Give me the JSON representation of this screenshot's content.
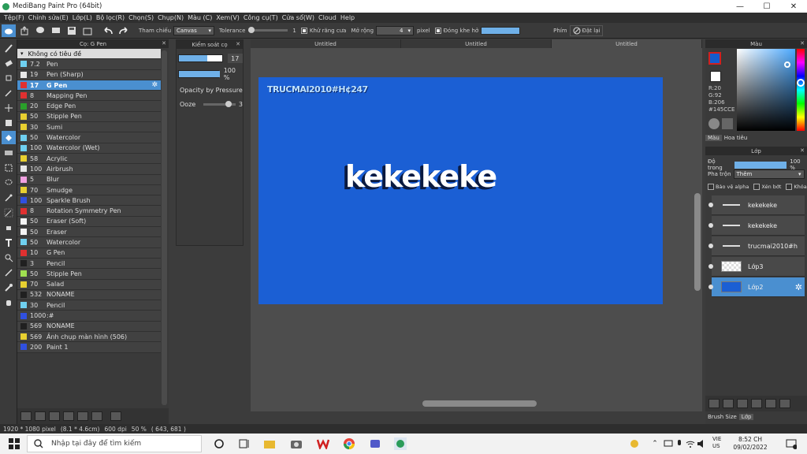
{
  "window": {
    "title": "MediBang Paint Pro (64bit)",
    "min": "—",
    "max": "☐",
    "close": "✕"
  },
  "menu": [
    "Tệp(F)",
    "Chỉnh sửa(E)",
    "Lớp(L)",
    "Bộ lọc(R)",
    "Chọn(S)",
    "Chụp(N)",
    "Màu (C)",
    "Xem(V)",
    "Công cụ(T)",
    "Cửa sổ(W)",
    "Cloud",
    "Help"
  ],
  "toolbar": {
    "reference_label": "Tham chiếu",
    "reference_value": "Canvas",
    "tolerance_label": "Tolerance",
    "tolerance_value": "1",
    "antialias_label": "Khử răng cưa",
    "expand_label": "Mở rộng",
    "expand_value": "4",
    "expand_unit": "pixel",
    "gap_label": "Đóng khe hở",
    "phim_label": "Phím",
    "reset_label": "Đặt lại"
  },
  "brush_panel": {
    "title": "Cọ: G Pen",
    "category": "Không có tiêu đề",
    "items": [
      {
        "size": "7.2",
        "name": "Pen",
        "color": "#6fd0f0",
        "selected": false
      },
      {
        "size": "19",
        "name": "Pen (Sharp)",
        "color": "#e8e8e8",
        "selected": false
      },
      {
        "size": "17",
        "name": "G Pen",
        "color": "#e03030",
        "selected": true
      },
      {
        "size": "8",
        "name": "Mapping Pen",
        "color": "#e03030",
        "selected": false
      },
      {
        "size": "20",
        "name": "Edge Pen",
        "color": "#2aa02a",
        "selected": false
      },
      {
        "size": "50",
        "name": "Stipple Pen",
        "color": "#e8d030",
        "selected": false
      },
      {
        "size": "30",
        "name": "Sumi",
        "color": "#e8d030",
        "selected": false
      },
      {
        "size": "50",
        "name": "Watercolor",
        "color": "#6fd0f0",
        "selected": false
      },
      {
        "size": "100",
        "name": "Watercolor (Wet)",
        "color": "#6fd0f0",
        "selected": false
      },
      {
        "size": "58",
        "name": "Acrylic",
        "color": "#e8d030",
        "selected": false
      },
      {
        "size": "100",
        "name": "Airbrush",
        "color": "#e8e8e8",
        "selected": false
      },
      {
        "size": "5",
        "name": "Blur",
        "color": "#f0a0e0",
        "selected": false
      },
      {
        "size": "70",
        "name": "Smudge",
        "color": "#e8d030",
        "selected": false
      },
      {
        "size": "100",
        "name": "Sparkle Brush",
        "color": "#3050e0",
        "selected": false
      },
      {
        "size": "8",
        "name": "Rotation Symmetry Pen",
        "color": "#e03030",
        "selected": false
      },
      {
        "size": "50",
        "name": "Eraser (Soft)",
        "color": "#f4f4f4",
        "selected": false
      },
      {
        "size": "50",
        "name": "Eraser",
        "color": "#f4f4f4",
        "selected": false
      },
      {
        "size": "50",
        "name": "Watercolor",
        "color": "#6fd0f0",
        "selected": false
      },
      {
        "size": "10",
        "name": "G Pen",
        "color": "#e03030",
        "selected": false
      },
      {
        "size": "3",
        "name": "Pencil",
        "color": "#202020",
        "selected": false
      },
      {
        "size": "50",
        "name": "Stipple Pen",
        "color": "#a0e050",
        "selected": false
      },
      {
        "size": "70",
        "name": "Salad",
        "color": "#e8d030",
        "selected": false
      },
      {
        "size": "532",
        "name": "NONAME",
        "color": "#202020",
        "selected": false
      },
      {
        "size": "30",
        "name": "Pencil",
        "color": "#6fd0f0",
        "selected": false
      },
      {
        "size": "1000",
        "name": ":#",
        "color": "#3050e0",
        "selected": false
      },
      {
        "size": "569",
        "name": "NONAME",
        "color": "#202020",
        "selected": false
      },
      {
        "size": "569",
        "name": "Ảnh chụp màn hình (506)",
        "color": "#e8d030",
        "selected": false
      },
      {
        "size": "200",
        "name": "Paint 1",
        "color": "#3050e0",
        "selected": false
      }
    ]
  },
  "brush_control": {
    "title": "Kiểm soát cọ",
    "size_value": "17",
    "opacity_value": "100 %",
    "opacity_fraction": 1.0,
    "size_fraction": 0.65,
    "pressure_label": "Opacity by Pressure",
    "ooze_label": "Ooze",
    "ooze_value": "3",
    "ooze_fraction": 0.8
  },
  "tabs": [
    "Untitled",
    "Untitled",
    "Untitled"
  ],
  "canvas": {
    "small_text": "TRUCMAI2010#H¢247",
    "big_text": "kekekeke",
    "bg_color": "#1b5fd4"
  },
  "color_panel": {
    "title": "Màu",
    "r": "R:20",
    "g": "G:92",
    "b": "B:206",
    "hex": "#145CCE",
    "tab_color": "Màu",
    "tab_palette": "Hoa tiêu"
  },
  "layer_panel": {
    "title": "Lớp",
    "opacity_label": "Độ trong",
    "opacity_value": "100 %",
    "blend_label": "Pha trộn",
    "blend_value": "Thêm",
    "protect_alpha": "Bảo vệ alpha",
    "clipping": "Xén bớt",
    "lock": "Khóa",
    "layers": [
      {
        "name": "kekekeke",
        "selected": false
      },
      {
        "name": "kekekeke",
        "selected": false
      },
      {
        "name": "trucmai2010#h",
        "selected": false
      },
      {
        "name": "Lớp3",
        "selected": false
      },
      {
        "name": "Lớp2",
        "selected": true
      }
    ],
    "bottom_tabs": [
      "Brush Size",
      "Lớp"
    ]
  },
  "status": {
    "size": "1920 * 1080 pixel",
    "cm": "(8.1 * 4.6cm)",
    "dpi": "600 dpi",
    "zoom": "50 %",
    "coords": "( 643, 681 )"
  },
  "taskbar": {
    "search_placeholder": "Nhập tại đây để tìm kiếm",
    "lang1": "VIE",
    "lang2": "US",
    "time": "8:52 CH",
    "date": "09/02/2022"
  }
}
